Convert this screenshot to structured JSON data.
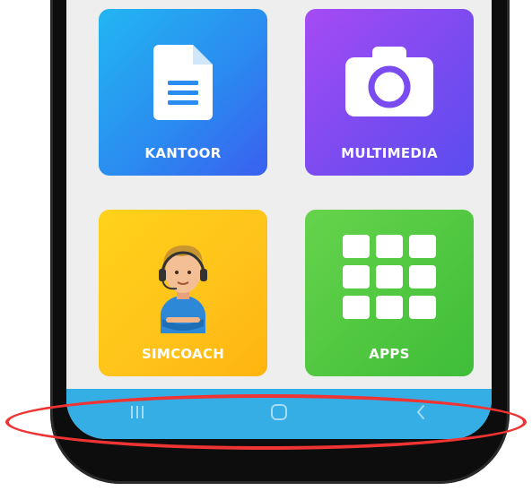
{
  "tiles": {
    "kantoor": {
      "label": "KANTOOR",
      "icon": "document-icon"
    },
    "multimedia": {
      "label": "MULTIMEDIA",
      "icon": "camera-icon"
    },
    "simcoach": {
      "label": "SIMCOACH",
      "icon": "coach-avatar-icon"
    },
    "apps": {
      "label": "APPS",
      "icon": "app-grid-icon"
    }
  },
  "navbar": {
    "recents_icon": "recents-icon",
    "home_icon": "home-icon",
    "back_icon": "back-icon"
  },
  "colors": {
    "kantoor": "#2a8cf0",
    "multimedia": "#8a4cf2",
    "simcoach": "#ffc61a",
    "apps": "#4ec63f",
    "navbar": "#34aee4",
    "highlight": "#f03434",
    "screen_background": "#eeeeef"
  }
}
